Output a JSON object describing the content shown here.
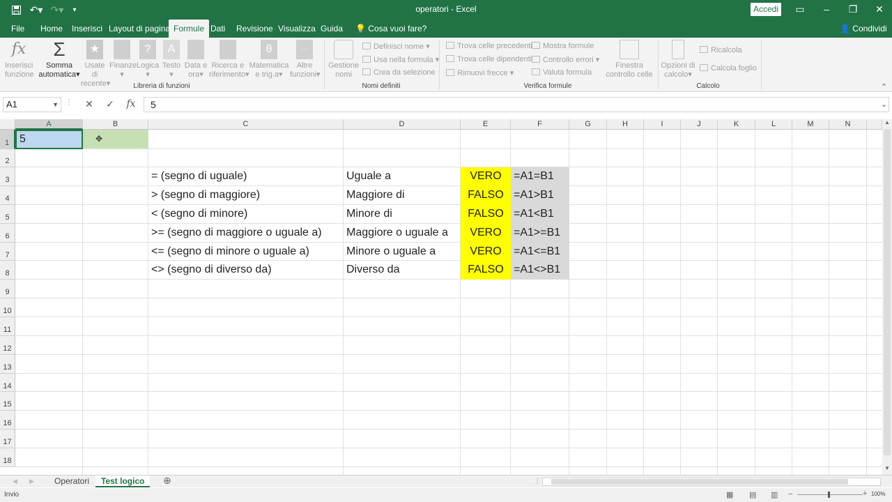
{
  "titlebar": {
    "title": "operatori  -  Excel",
    "accedi": "Accedi"
  },
  "tabs": [
    "File",
    "Home",
    "Inserisci",
    "Layout di pagina",
    "Formule",
    "Dati",
    "Revisione",
    "Visualizza",
    "Guida"
  ],
  "active_tab": "Formule",
  "tell_me": "Cosa vuoi fare?",
  "share": "Condividi",
  "ribbon": {
    "insert_function": "Inserisci funzione",
    "autosum_1": "Somma",
    "autosum_2": "automatica",
    "recent_1": "Usate di",
    "recent_2": "recente",
    "finance": "Finanze",
    "logic": "Logica",
    "text": "Testo",
    "date_1": "Data e",
    "date_2": "ora",
    "lookup_1": "Ricerca e",
    "lookup_2": "riferimento",
    "math_1": "Matematica",
    "math_2": "e trig.a",
    "more_1": "Altre",
    "more_2": "funzioni",
    "group_library": "Libreria di funzioni",
    "name_mgr_1": "Gestione",
    "name_mgr_2": "nomi",
    "define_name": "Definisci nome",
    "use_in_formula": "Usa nella formula",
    "create_from_sel": "Crea da selezione",
    "group_names": "Nomi definiti",
    "trace_prec": "Trova celle precedenti",
    "trace_dep": "Trova celle dipendenti",
    "remove_arrows": "Rimuovi frecce",
    "show_formulas": "Mostra formule",
    "error_check": "Controllo errori",
    "evaluate": "Valuta formula",
    "group_audit": "Verifica formule",
    "watch_1": "Finestra",
    "watch_2": "controllo celle",
    "calc_opts_1": "Opzioni di",
    "calc_opts_2": "calcolo",
    "recalc": "Ricalcola",
    "calc_sheet": "Calcola foglio",
    "group_calc": "Calcolo"
  },
  "formula_bar": {
    "name_box": "A1",
    "value": "5"
  },
  "columns": [
    "A",
    "B",
    "C",
    "D",
    "E",
    "F",
    "G",
    "H",
    "I",
    "J",
    "K",
    "L",
    "M",
    "N"
  ],
  "rows": [
    "1",
    "2",
    "3",
    "4",
    "5",
    "6",
    "7",
    "8",
    "9",
    "10",
    "11",
    "12",
    "13",
    "14",
    "15",
    "16",
    "17",
    "18"
  ],
  "cells": {
    "A1": "5",
    "C": [
      "= (segno di uguale)",
      "> (segno di maggiore)",
      "< (segno di minore)",
      ">= (segno di maggiore o uguale a)",
      "<= (segno di minore o uguale a)",
      "<> (segno di diverso da)"
    ],
    "D": [
      "Uguale a",
      "Maggiore di",
      "Minore di",
      "Maggiore o uguale a",
      "Minore o uguale a",
      "Diverso da"
    ],
    "E": [
      "VERO",
      "FALSO",
      "FALSO",
      "VERO",
      "VERO",
      "FALSO"
    ],
    "F": [
      "=A1=B1",
      "=A1>B1",
      "=A1<B1",
      "=A1>=B1",
      "=A1<=B1",
      "=A1<>B1"
    ]
  },
  "sheets": [
    "Operatori",
    "Test logico"
  ],
  "active_sheet": "Test logico",
  "status_text": "Invio",
  "zoom": "100%",
  "colors": {
    "excel_green": "#217346",
    "highlight_yellow": "#ffff00",
    "formula_gray": "#d9d9d9",
    "selection_blue": "#bdd7ee",
    "b1_green": "#c6e0b4"
  }
}
